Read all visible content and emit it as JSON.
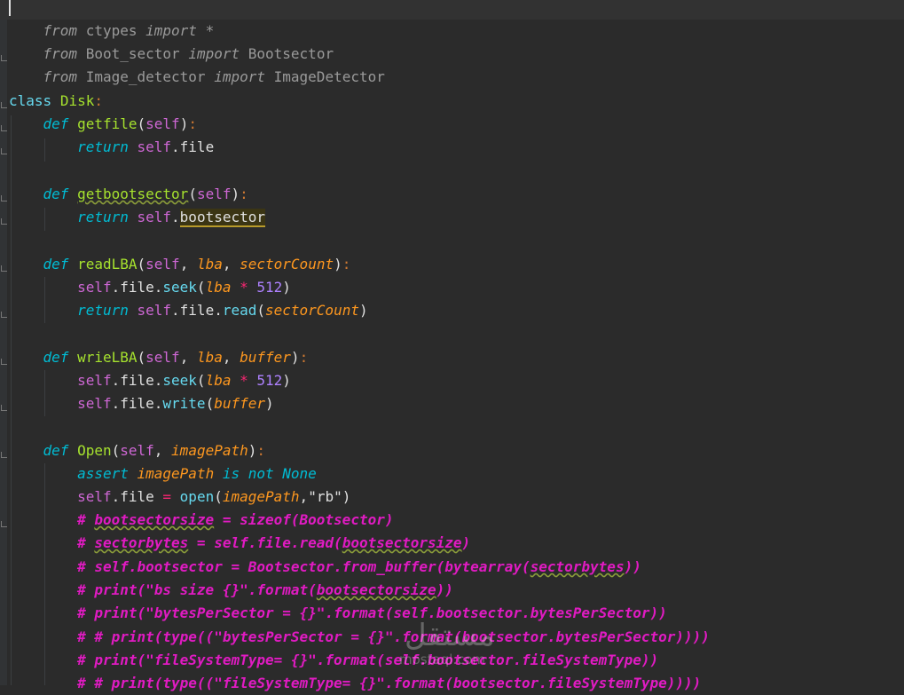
{
  "code": {
    "l1": {
      "kw1": "from",
      "mod": "ctypes",
      "kw2": "import",
      "sym": "*"
    },
    "l2": {
      "kw1": "from",
      "mod": "Boot_sector",
      "kw2": "import",
      "sym": "Bootsector"
    },
    "l3": {
      "kw1": "from",
      "mod": "Image_detector",
      "kw2": "import",
      "sym": "ImageDetector"
    },
    "l5": {
      "kw": "class",
      "name": "Disk",
      "colon": ":"
    },
    "l6": {
      "kw": "def",
      "name": "getfile",
      "open": "(",
      "self": "self",
      "close": ")",
      "colon": ":"
    },
    "l7": {
      "kw": "return",
      "self": "self",
      "rest": ".file"
    },
    "l9": {
      "kw": "def",
      "name": "getbootsector",
      "open": "(",
      "self": "self",
      "close": ")",
      "colon": ":"
    },
    "l10": {
      "kw": "return",
      "self": "self",
      "dot": ".",
      "attr": "bootsector"
    },
    "l12": {
      "kw": "def",
      "name": "readLBA",
      "open": "(",
      "self": "self",
      "sep1": ", ",
      "p1": "lba",
      "sep2": ", ",
      "p2": "sectorCount",
      "close": ")",
      "colon": ":"
    },
    "l13": {
      "self": "self",
      "a": ".file.",
      "m": "seek",
      "open": "(",
      "p": "lba",
      "op": " * ",
      "num": "512",
      "close": ")"
    },
    "l14": {
      "kw": "return",
      "self": "self",
      "a": ".file.",
      "m": "read",
      "open": "(",
      "p": "sectorCount",
      "close": ")"
    },
    "l16": {
      "kw": "def",
      "name": "wrieLBA",
      "open": "(",
      "self": "self",
      "sep1": ", ",
      "p1": "lba",
      "sep2": ", ",
      "p2": "buffer",
      "close": ")",
      "colon": ":"
    },
    "l17": {
      "self": "self",
      "a": ".file.",
      "m": "seek",
      "open": "(",
      "p": "lba",
      "op": " * ",
      "num": "512",
      "close": ")"
    },
    "l18": {
      "self": "self",
      "a": ".file.",
      "m": "write",
      "open": "(",
      "p": "buffer",
      "close": ")"
    },
    "l20": {
      "kw": "def",
      "name": "Open",
      "open": "(",
      "self": "self",
      "sep1": ", ",
      "p1": "imagePath",
      "close": ")",
      "colon": ":"
    },
    "l21": {
      "kw1": "assert",
      "p": "imagePath",
      "kw2": "is not",
      "kw3": "None"
    },
    "l22": {
      "self": "self",
      "a": ".file ",
      "eq": "=",
      "sp": " ",
      "fn": "open",
      "open": "(",
      "p": "imagePath",
      "c": ",",
      "s": "\"rb\"",
      "close": ")"
    },
    "l23": {
      "h": "# ",
      "w1": "bootsectorsize",
      "rest": " = sizeof(Bootsector)"
    },
    "l24": {
      "h": "# ",
      "w1": "sectorbytes",
      "mid": " = self.file.read(",
      "w2": "bootsectorsize",
      "end": ")"
    },
    "l25": {
      "pre": "# self.bootsector = Bootsector.from_buffer(bytearray(",
      "w1": "sectorbytes",
      "end": "))"
    },
    "l26": {
      "pre": "# print(\"bs size {}\".format(",
      "w1": "bootsectorsize",
      "end": "))"
    },
    "l27": {
      "text": "# print(\"bytesPerSector = {}\".format(self.bootsector.bytesPerSector))"
    },
    "l28": {
      "text": "# # print(type((\"bytesPerSector = {}\".format(bootsector.bytesPerSector))))"
    },
    "l29": {
      "text": "# print(\"fileSystemType= {}\".format(self.bootsector.fileSystemType))"
    },
    "l30": {
      "text": "# # print(type((\"fileSystemType= {}\".format(bootsector.fileSystemType))))"
    }
  },
  "watermark": {
    "arabic": "مستقل",
    "latin": "mostaql.com"
  }
}
